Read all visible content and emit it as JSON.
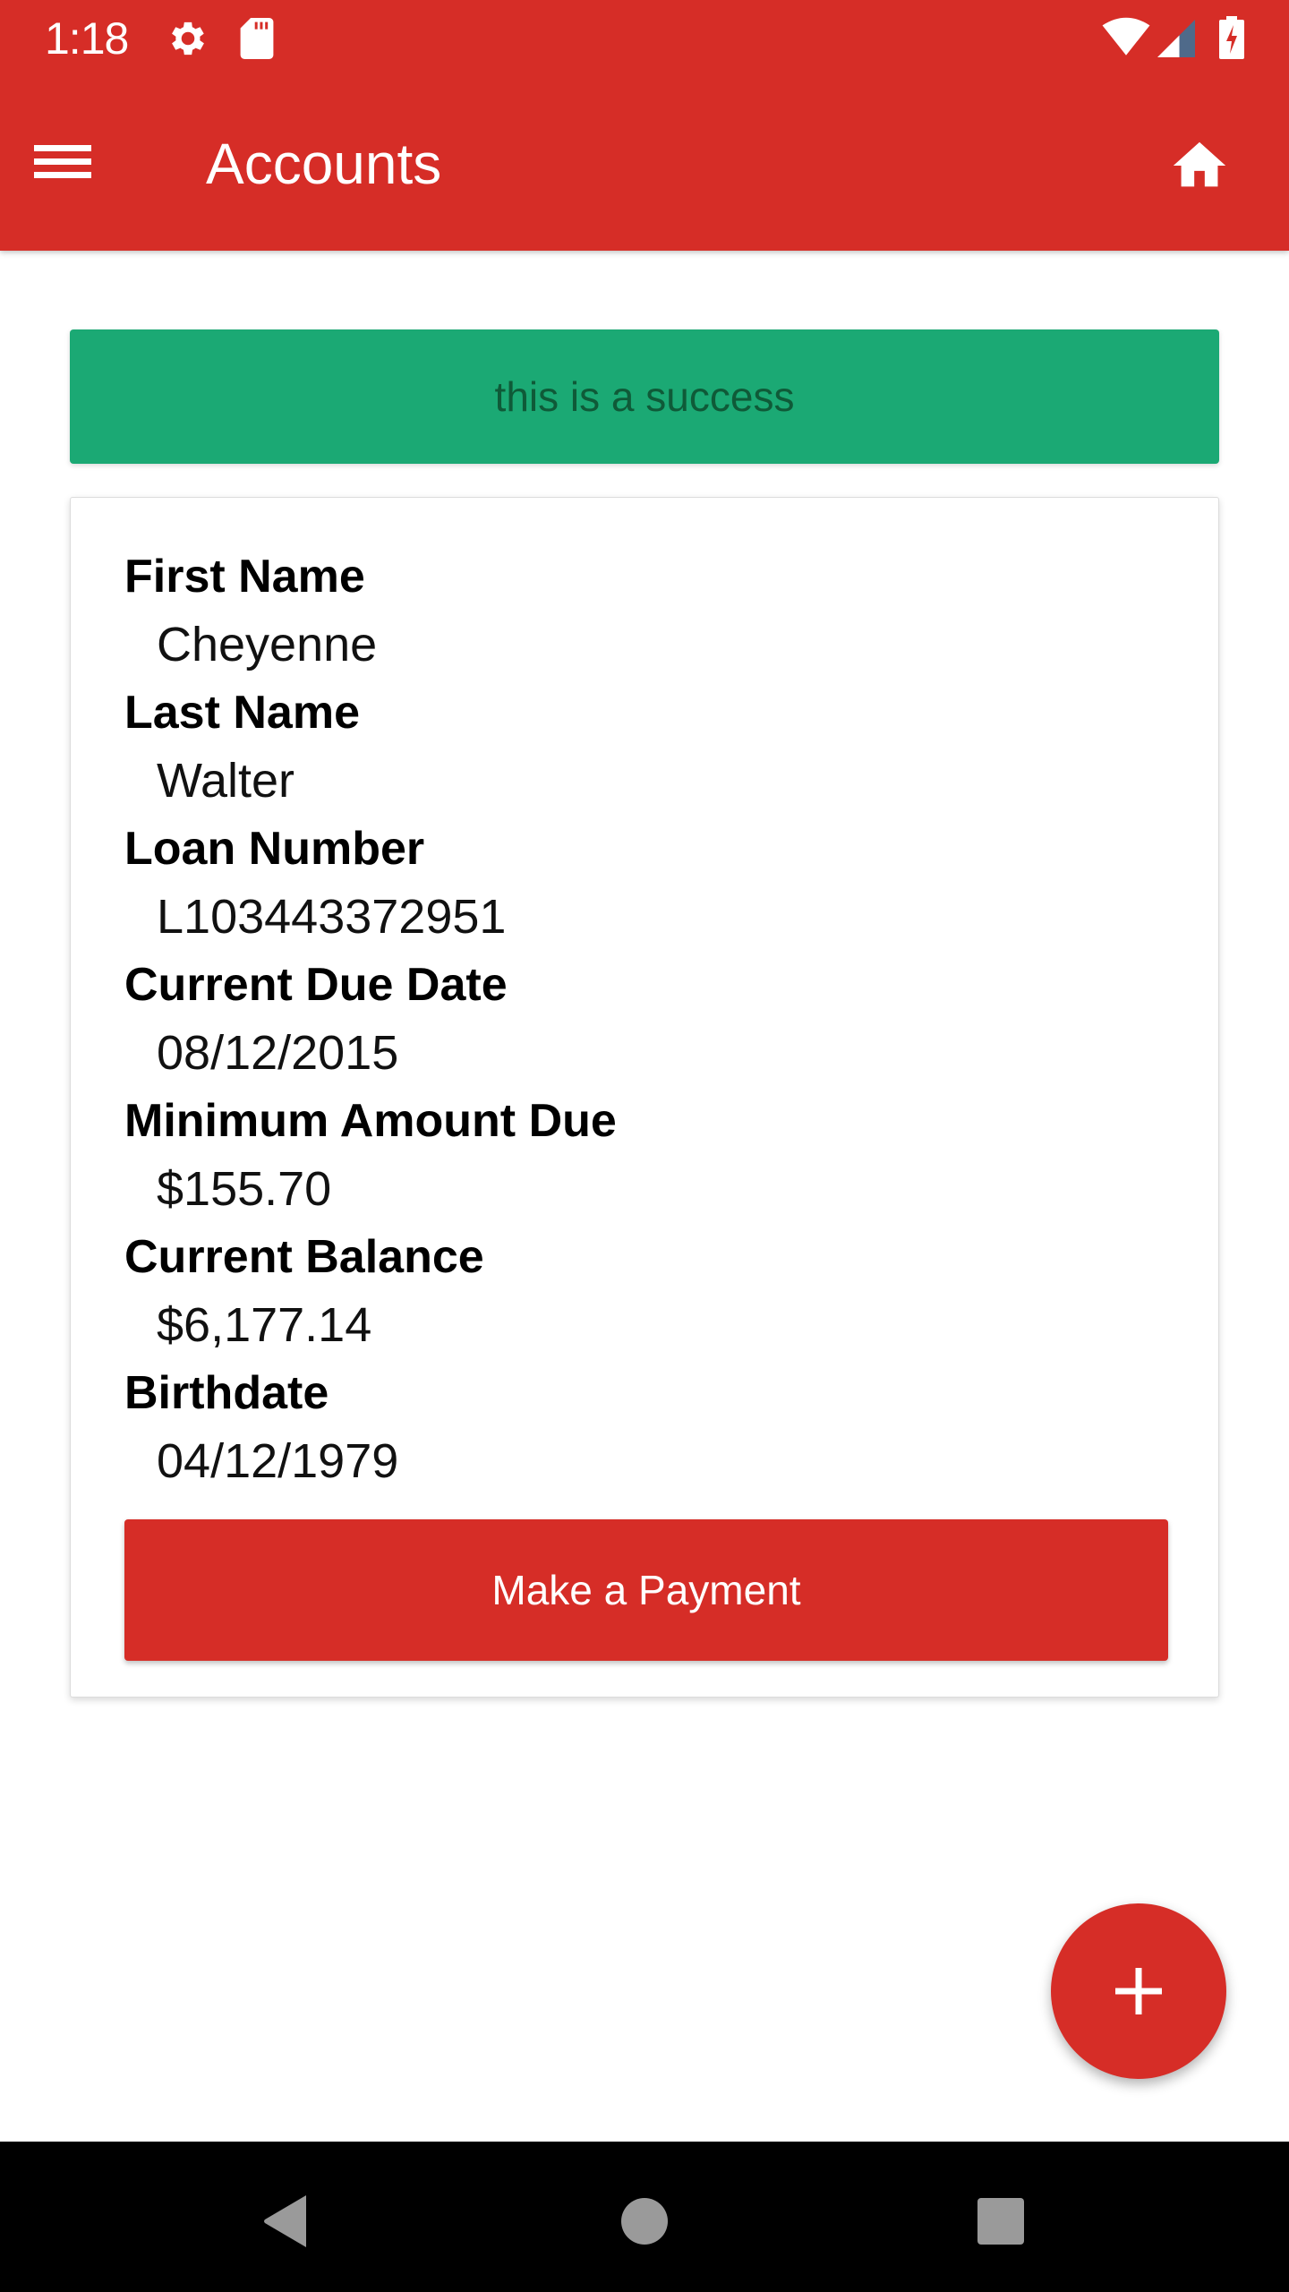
{
  "status_bar": {
    "time": "1:18",
    "left_icons": [
      "settings-icon",
      "sd-card-icon"
    ],
    "right_icons": [
      "wifi-icon",
      "signal-icon",
      "battery-charging-icon"
    ]
  },
  "app_bar": {
    "title": "Accounts",
    "nav_icon": "menu-icon",
    "action_icon": "home-icon"
  },
  "banner": {
    "message": "this is a success",
    "background_color": "#1ba974",
    "text_color": "#0f5a38"
  },
  "account": {
    "fields": [
      {
        "label": "First Name",
        "value": "Cheyenne"
      },
      {
        "label": "Last Name",
        "value": "Walter"
      },
      {
        "label": "Loan Number",
        "value": "L103443372951"
      },
      {
        "label": "Current Due Date",
        "value": "08/12/2015"
      },
      {
        "label": "Minimum Amount Due",
        "value": "$155.70"
      },
      {
        "label": "Current Balance",
        "value": "$6,177.14"
      },
      {
        "label": "Birthdate",
        "value": "04/12/1979"
      }
    ],
    "payment_button_label": "Make a Payment"
  },
  "fab": {
    "icon": "add-icon"
  },
  "nav_bar": {
    "buttons": [
      "back-icon",
      "home-circle-icon",
      "recents-icon"
    ]
  },
  "colors": {
    "primary": "#d62d27",
    "success": "#1ba974",
    "nav_bar": "#000000",
    "nav_icon": "#9a9a9a"
  }
}
